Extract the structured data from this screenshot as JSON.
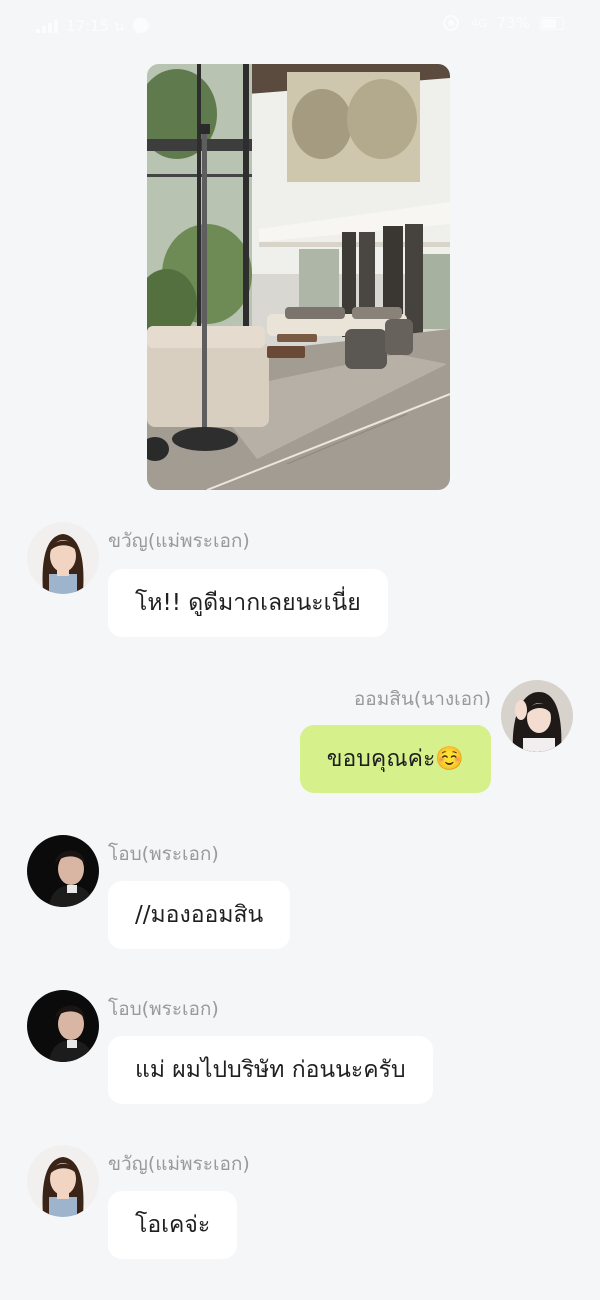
{
  "status_bar": {
    "time": "17:15 น",
    "network": "4G",
    "battery": "73%"
  },
  "messages": [
    {
      "sender": "ขวัญ(แม่พระเอก)",
      "text": "โห!! ดูดีมากเลยนะเนี่ย",
      "side": "left",
      "avatar": "avatar-woman-long-hair"
    },
    {
      "sender": "ออมสิน(นางเอก)",
      "text": "ขอบคุณค่ะ☺️",
      "side": "right",
      "avatar": "avatar-woman-hand-on-head"
    },
    {
      "sender": "โอบ(พระเอก)",
      "text": "//มองออมสิน",
      "side": "left",
      "avatar": "avatar-man-dark"
    },
    {
      "sender": "โอบ(พระเอก)",
      "text": "แม่ ผมไปบริษัท ก่อนนะครับ",
      "side": "left",
      "avatar": "avatar-man-dark"
    },
    {
      "sender": "ขวัญ(แม่พระเอก)",
      "text": "โอเคจ่ะ",
      "side": "left",
      "avatar": "avatar-woman-long-hair"
    }
  ],
  "colors": {
    "background": "#f5f6f8",
    "bubble_incoming": "#ffffff",
    "bubble_outgoing": "#d6f08c",
    "sender_name": "#9a9a9a"
  }
}
